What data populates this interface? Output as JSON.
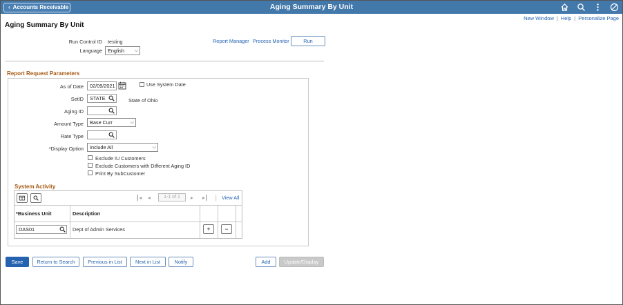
{
  "header": {
    "back_label": "Accounts Receivable",
    "title": "Aging Summary By Unit",
    "icons": [
      "home-icon",
      "search-icon",
      "more-icon",
      "no-entry-icon"
    ]
  },
  "top_links": {
    "new_window": "New Window",
    "help": "Help",
    "personalize": "Personalize Page",
    "sep": "|"
  },
  "page_title": "Aging Summary By Unit",
  "run_control": {
    "run_control_label": "Run Control ID",
    "run_control_value": "testing",
    "language_label": "Language",
    "language_value": "English",
    "report_manager": "Report Manager",
    "process_monitor": "Process Monitor",
    "run_button": "Run"
  },
  "params": {
    "section_title": "Report Request Parameters",
    "as_of_date_label": "As of Date",
    "as_of_date_value": "02/09/2021",
    "use_system_date_label": "Use System Date",
    "setid_label": "SetID",
    "setid_value": "STATE",
    "setid_desc": "State of Ohio",
    "aging_id_label": "Aging ID",
    "aging_id_value": "",
    "amount_type_label": "Amount Type",
    "amount_type_value": "Base Curr",
    "rate_type_label": "Rate Type",
    "rate_type_value": "",
    "display_option_label": "*Display Option",
    "display_option_value": "Include All",
    "checkboxes": [
      "Exclude IU Customers",
      "Exclude Customers with Different Aging ID",
      "Print By SubCustomer"
    ]
  },
  "system_activity": {
    "title": "System Activity",
    "pager_text": "1-1 of 1",
    "view_all": "View All",
    "col_business_unit": "*Business Unit",
    "col_description": "Description",
    "row": {
      "business_unit": "DAS01",
      "description": "Dept of Admin Services"
    },
    "add_row": "+",
    "delete_row": "−"
  },
  "footer": {
    "save": "Save",
    "return_to_search": "Return to Search",
    "previous_in_list": "Previous in List",
    "next_in_list": "Next in List",
    "notify": "Notify",
    "add": "Add",
    "update_display": "Update/Display"
  },
  "colors": {
    "header_bg": "#4378ab",
    "link": "#2563b0",
    "section_title": "#a65a14",
    "primary_btn": "#2563b0"
  }
}
